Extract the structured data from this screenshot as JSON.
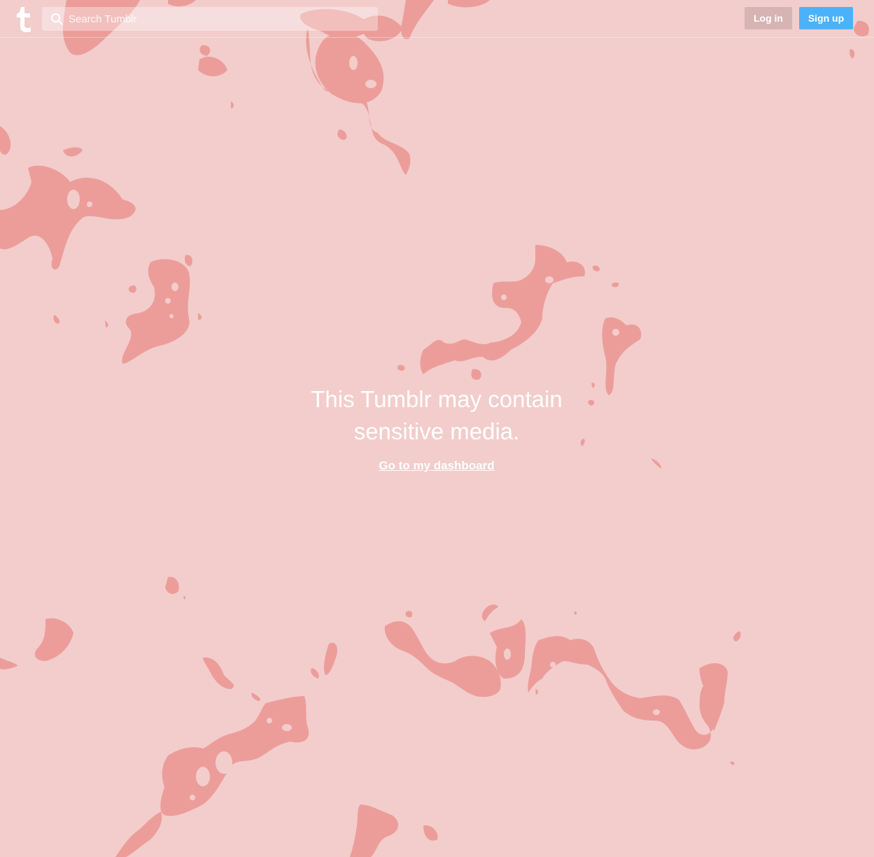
{
  "header": {
    "search_placeholder": "Search Tumblr",
    "login_label": "Log in",
    "signup_label": "Sign up"
  },
  "notice": {
    "title_line1": "This Tumblr may contain",
    "title_line2": "sensitive media.",
    "link_label": "Go to my dashboard"
  },
  "colors": {
    "background": "#f2cdcc",
    "blob": "#ec9d9a",
    "signup": "#4bb2f9",
    "login": "#d6b4b3",
    "text": "#ffffff"
  },
  "icons": {
    "logo": "tumblr-logo-icon",
    "search": "search-icon"
  }
}
